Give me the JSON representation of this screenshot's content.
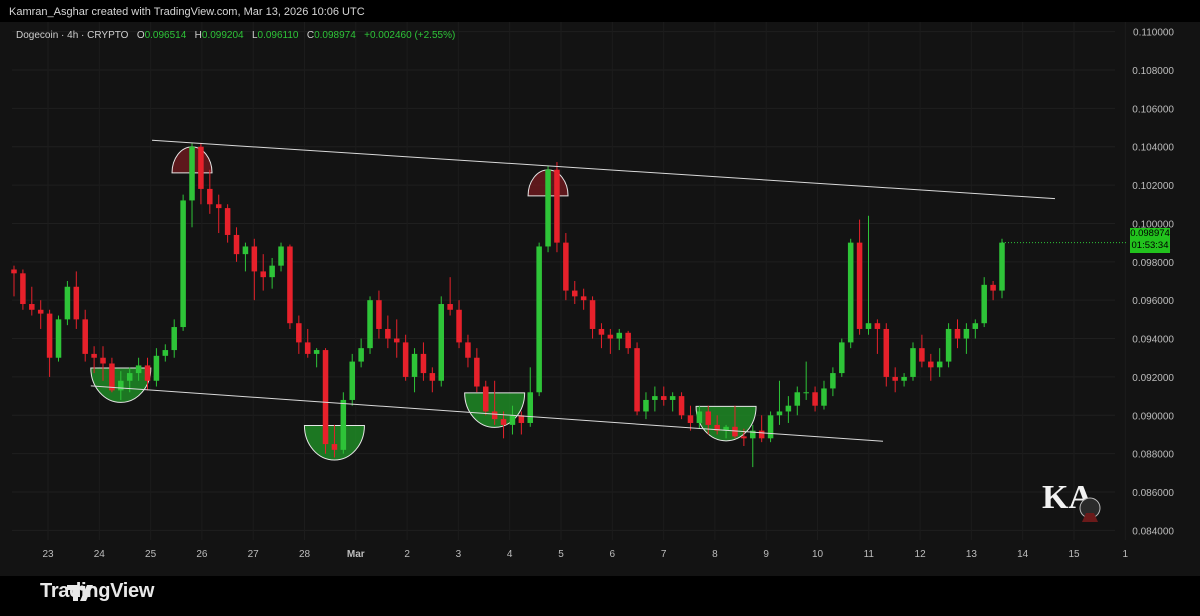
{
  "header": {
    "credit": "Kamran_Asghar created with TradingView.com, Mar 13, 2026 10:06 UTC"
  },
  "legend": {
    "symbol": "Dogecoin · 4h · CRYPTO",
    "open_label": "O",
    "open": "0.096514",
    "high_label": "H",
    "high": "0.099204",
    "low_label": "L",
    "low": "0.096110",
    "close_label": "C",
    "close": "0.098974",
    "change": "+0.002460 (+2.55%)"
  },
  "price_tag": {
    "price": "0.098974",
    "countdown": "01:53:34"
  },
  "footer": {
    "brand": "TradingView"
  },
  "watermark": {
    "text": "KA"
  },
  "colors": {
    "up": "#2ec438",
    "down": "#e7212b",
    "background": "#131313",
    "trendline": "#d9d9d9",
    "top_marker": "#6b1a1f",
    "bottom_marker": "#1f8a26"
  },
  "chart_data": {
    "type": "candlestick",
    "symbol": "Dogecoin",
    "interval": "4h",
    "ylim": [
      0.0835,
      0.1105
    ],
    "y_ticks": [
      "0.084000",
      "0.086000",
      "0.088000",
      "0.090000",
      "0.092000",
      "0.094000",
      "0.096000",
      "0.098000",
      "0.100000",
      "0.102000",
      "0.104000",
      "0.106000",
      "0.108000",
      "0.110000"
    ],
    "x_ticks": [
      "23",
      "24",
      "25",
      "26",
      "27",
      "28",
      "Mar",
      "2",
      "3",
      "4",
      "5",
      "6",
      "7",
      "8",
      "9",
      "10",
      "11",
      "12",
      "13",
      "14",
      "15",
      "1"
    ],
    "candles": [
      [
        0.0976,
        0.0978,
        0.0962,
        0.0974
      ],
      [
        0.0974,
        0.0976,
        0.0955,
        0.0958
      ],
      [
        0.0958,
        0.0967,
        0.0952,
        0.0955
      ],
      [
        0.0955,
        0.096,
        0.0945,
        0.0953
      ],
      [
        0.0953,
        0.0955,
        0.092,
        0.093
      ],
      [
        0.093,
        0.0952,
        0.0928,
        0.095
      ],
      [
        0.095,
        0.097,
        0.0947,
        0.0967
      ],
      [
        0.0967,
        0.0975,
        0.0945,
        0.095
      ],
      [
        0.095,
        0.0955,
        0.0928,
        0.0932
      ],
      [
        0.0932,
        0.0936,
        0.0922,
        0.093
      ],
      [
        0.093,
        0.0936,
        0.0918,
        0.0927
      ],
      [
        0.0927,
        0.093,
        0.0912,
        0.0913
      ],
      [
        0.0913,
        0.0923,
        0.0908,
        0.0918
      ],
      [
        0.0918,
        0.0925,
        0.0912,
        0.0922
      ],
      [
        0.0922,
        0.093,
        0.0918,
        0.0926
      ],
      [
        0.0926,
        0.093,
        0.0913,
        0.0918
      ],
      [
        0.0918,
        0.0935,
        0.0915,
        0.0931
      ],
      [
        0.0931,
        0.0937,
        0.0928,
        0.0934
      ],
      [
        0.0934,
        0.095,
        0.093,
        0.0946
      ],
      [
        0.0946,
        0.1015,
        0.0944,
        0.1012
      ],
      [
        0.1012,
        0.1042,
        0.0998,
        0.104
      ],
      [
        0.104,
        0.1042,
        0.101,
        0.1018
      ],
      [
        0.1018,
        0.1028,
        0.1005,
        0.101
      ],
      [
        0.101,
        0.1015,
        0.0995,
        0.1008
      ],
      [
        0.1008,
        0.101,
        0.099,
        0.0994
      ],
      [
        0.0994,
        0.0998,
        0.098,
        0.0984
      ],
      [
        0.0984,
        0.099,
        0.0975,
        0.0988
      ],
      [
        0.0988,
        0.0992,
        0.096,
        0.0975
      ],
      [
        0.0975,
        0.0984,
        0.0965,
        0.0972
      ],
      [
        0.0972,
        0.0982,
        0.0966,
        0.0978
      ],
      [
        0.0978,
        0.099,
        0.0975,
        0.0988
      ],
      [
        0.0988,
        0.0989,
        0.0945,
        0.0948
      ],
      [
        0.0948,
        0.0952,
        0.0932,
        0.0938
      ],
      [
        0.0938,
        0.0945,
        0.093,
        0.0932
      ],
      [
        0.0932,
        0.0935,
        0.0925,
        0.0934
      ],
      [
        0.0934,
        0.0935,
        0.088,
        0.0885
      ],
      [
        0.0885,
        0.0895,
        0.0878,
        0.0882
      ],
      [
        0.0882,
        0.0912,
        0.088,
        0.0908
      ],
      [
        0.0908,
        0.0932,
        0.0905,
        0.0928
      ],
      [
        0.0928,
        0.094,
        0.0925,
        0.0935
      ],
      [
        0.0935,
        0.0962,
        0.0932,
        0.096
      ],
      [
        0.096,
        0.0965,
        0.094,
        0.0945
      ],
      [
        0.0945,
        0.0952,
        0.0935,
        0.094
      ],
      [
        0.094,
        0.095,
        0.093,
        0.0938
      ],
      [
        0.0938,
        0.0942,
        0.0918,
        0.092
      ],
      [
        0.092,
        0.0935,
        0.0912,
        0.0932
      ],
      [
        0.0932,
        0.0938,
        0.0918,
        0.0922
      ],
      [
        0.0922,
        0.0925,
        0.0912,
        0.0918
      ],
      [
        0.0918,
        0.0962,
        0.0915,
        0.0958
      ],
      [
        0.0958,
        0.0972,
        0.0952,
        0.0955
      ],
      [
        0.0955,
        0.096,
        0.0935,
        0.0938
      ],
      [
        0.0938,
        0.0942,
        0.0925,
        0.093
      ],
      [
        0.093,
        0.0935,
        0.0912,
        0.0915
      ],
      [
        0.0915,
        0.0918,
        0.09,
        0.0902
      ],
      [
        0.0902,
        0.0918,
        0.0895,
        0.0898
      ],
      [
        0.0898,
        0.0902,
        0.0888,
        0.0895
      ],
      [
        0.0895,
        0.0905,
        0.089,
        0.09
      ],
      [
        0.09,
        0.0902,
        0.089,
        0.0896
      ],
      [
        0.0896,
        0.0925,
        0.0894,
        0.0912
      ],
      [
        0.0912,
        0.099,
        0.091,
        0.0988
      ],
      [
        0.0988,
        0.103,
        0.0985,
        0.1028
      ],
      [
        0.1028,
        0.1032,
        0.0985,
        0.099
      ],
      [
        0.099,
        0.0995,
        0.096,
        0.0965
      ],
      [
        0.0965,
        0.097,
        0.0958,
        0.0962
      ],
      [
        0.0962,
        0.0966,
        0.0955,
        0.096
      ],
      [
        0.096,
        0.0962,
        0.094,
        0.0945
      ],
      [
        0.0945,
        0.0948,
        0.0935,
        0.0942
      ],
      [
        0.0942,
        0.0945,
        0.0932,
        0.094
      ],
      [
        0.094,
        0.0945,
        0.0934,
        0.0943
      ],
      [
        0.0943,
        0.0944,
        0.0932,
        0.0935
      ],
      [
        0.0935,
        0.0938,
        0.09,
        0.0902
      ],
      [
        0.0902,
        0.0912,
        0.0898,
        0.0908
      ],
      [
        0.0908,
        0.0915,
        0.0902,
        0.091
      ],
      [
        0.091,
        0.0915,
        0.0905,
        0.0908
      ],
      [
        0.0908,
        0.0912,
        0.0902,
        0.091
      ],
      [
        0.091,
        0.0912,
        0.0898,
        0.09
      ],
      [
        0.09,
        0.0905,
        0.0892,
        0.0896
      ],
      [
        0.0896,
        0.0905,
        0.0893,
        0.0902
      ],
      [
        0.0902,
        0.0905,
        0.089,
        0.0895
      ],
      [
        0.0895,
        0.09,
        0.089,
        0.0892
      ],
      [
        0.0892,
        0.0895,
        0.0888,
        0.0894
      ],
      [
        0.0894,
        0.0905,
        0.0888,
        0.0889
      ],
      [
        0.0889,
        0.0893,
        0.0884,
        0.0888
      ],
      [
        0.0888,
        0.0895,
        0.0873,
        0.0892
      ],
      [
        0.0892,
        0.09,
        0.0886,
        0.0888
      ],
      [
        0.0888,
        0.0902,
        0.0886,
        0.09
      ],
      [
        0.09,
        0.0918,
        0.0895,
        0.0902
      ],
      [
        0.0902,
        0.091,
        0.0896,
        0.0905
      ],
      [
        0.0905,
        0.0915,
        0.09,
        0.0912
      ],
      [
        0.0912,
        0.0928,
        0.0908,
        0.0912
      ],
      [
        0.0912,
        0.0915,
        0.0902,
        0.0905
      ],
      [
        0.0905,
        0.0918,
        0.0903,
        0.0914
      ],
      [
        0.0914,
        0.0925,
        0.091,
        0.0922
      ],
      [
        0.0922,
        0.094,
        0.092,
        0.0938
      ],
      [
        0.0938,
        0.0992,
        0.0935,
        0.099
      ],
      [
        0.099,
        0.1002,
        0.0942,
        0.0945
      ],
      [
        0.0945,
        0.1004,
        0.0942,
        0.0948
      ],
      [
        0.0948,
        0.095,
        0.0932,
        0.0945
      ],
      [
        0.0945,
        0.0948,
        0.0915,
        0.092
      ],
      [
        0.092,
        0.0925,
        0.0912,
        0.0918
      ],
      [
        0.0918,
        0.0922,
        0.0915,
        0.092
      ],
      [
        0.092,
        0.0938,
        0.0918,
        0.0935
      ],
      [
        0.0935,
        0.0942,
        0.0925,
        0.0928
      ],
      [
        0.0928,
        0.0932,
        0.0918,
        0.0925
      ],
      [
        0.0925,
        0.0935,
        0.092,
        0.0928
      ],
      [
        0.0928,
        0.0948,
        0.0925,
        0.0945
      ],
      [
        0.0945,
        0.095,
        0.0935,
        0.094
      ],
      [
        0.094,
        0.0948,
        0.0932,
        0.0945
      ],
      [
        0.0945,
        0.095,
        0.094,
        0.0948
      ],
      [
        0.0948,
        0.0972,
        0.0946,
        0.0968
      ],
      [
        0.0968,
        0.097,
        0.096,
        0.0965
      ],
      [
        0.0965,
        0.0992,
        0.0961,
        0.099
      ]
    ]
  }
}
